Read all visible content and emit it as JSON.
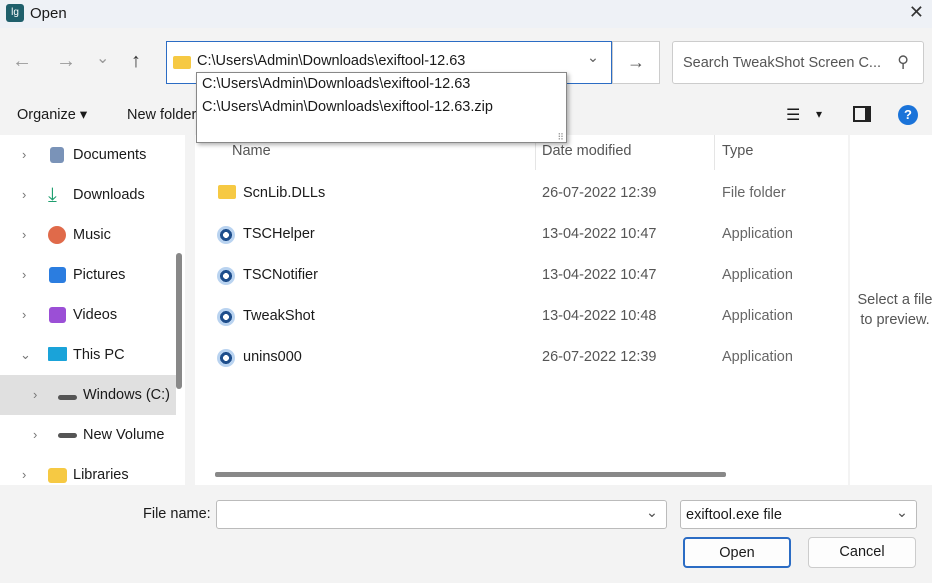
{
  "window": {
    "title": "Open",
    "close": "✕"
  },
  "nav": {
    "back": "←",
    "forward": "→",
    "recent": "⌄",
    "up": "↑",
    "go": "→"
  },
  "address": {
    "value": "C:\\Users\\Admin\\Downloads\\exiftool-12.63",
    "dropdown": "⌄"
  },
  "autocomplete": [
    "C:\\Users\\Admin\\Downloads\\exiftool-12.63",
    "C:\\Users\\Admin\\Downloads\\exiftool-12.63.zip"
  ],
  "search": {
    "placeholder": "Search TweakShot Screen C..."
  },
  "toolbar": {
    "organize": "Organize ▾",
    "new_folder": "New folder",
    "view": "☰",
    "view_drop": "▾",
    "help": "?"
  },
  "sidebar": {
    "items": [
      {
        "label": "Documents",
        "icon": "documents-icon",
        "color": "#7a93b8"
      },
      {
        "label": "Downloads",
        "icon": "downloads-icon",
        "color": "#1e9e6e"
      },
      {
        "label": "Music",
        "icon": "music-icon",
        "color": "#e06a4a"
      },
      {
        "label": "Pictures",
        "icon": "pictures-icon",
        "color": "#2b7de0"
      },
      {
        "label": "Videos",
        "icon": "videos-icon",
        "color": "#9b4fd6"
      },
      {
        "label": "This PC",
        "icon": "computer-icon",
        "color": "#1aa3d9"
      },
      {
        "label": "Windows (C:)",
        "icon": "drive-icon",
        "color": "#555555"
      },
      {
        "label": "New Volume",
        "icon": "drive-icon",
        "color": "#555555"
      },
      {
        "label": "Libraries",
        "icon": "folder-icon",
        "color": "#f6c943"
      }
    ]
  },
  "columns": {
    "name": "Name",
    "date": "Date modified",
    "type": "Type"
  },
  "files": [
    {
      "name": "ScnLib.DLLs",
      "date": "26-07-2022 12:39",
      "type": "File folder"
    },
    {
      "name": "TSCHelper",
      "date": "13-04-2022 10:47",
      "type": "Application"
    },
    {
      "name": "TSCNotifier",
      "date": "13-04-2022 10:47",
      "type": "Application"
    },
    {
      "name": "TweakShot",
      "date": "13-04-2022 10:48",
      "type": "Application"
    },
    {
      "name": "unins000",
      "date": "26-07-2022 12:39",
      "type": "Application"
    }
  ],
  "preview": {
    "text": "Select a file to preview."
  },
  "footer": {
    "file_name_label": "File name:",
    "file_name_value": "",
    "file_type": "exiftool.exe file",
    "open": "Open",
    "cancel": "Cancel"
  }
}
